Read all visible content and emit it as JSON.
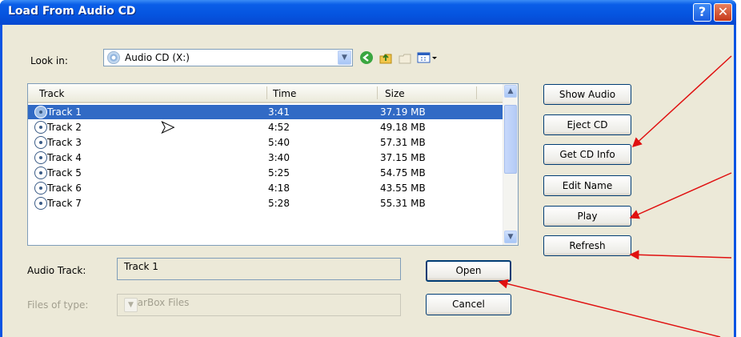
{
  "window": {
    "title": "Load From Audio CD"
  },
  "lookin": {
    "label": "Look in:",
    "value": "Audio CD (X:)"
  },
  "columns": [
    "Track",
    "Time",
    "Size"
  ],
  "tracks": [
    {
      "name": "Track 1",
      "time": "3:41",
      "size": "37.19 MB",
      "selected": true
    },
    {
      "name": "Track 2",
      "time": "4:52",
      "size": "49.18 MB"
    },
    {
      "name": "Track 3",
      "time": "5:40",
      "size": "57.31 MB"
    },
    {
      "name": "Track 4",
      "time": "3:40",
      "size": "37.15 MB"
    },
    {
      "name": "Track 5",
      "time": "5:25",
      "size": "54.75 MB"
    },
    {
      "name": "Track 6",
      "time": "4:18",
      "size": "43.55 MB"
    },
    {
      "name": "Track 7",
      "time": "5:28",
      "size": "55.31 MB"
    }
  ],
  "audio_track": {
    "label": "Audio Track:",
    "value": "Track 1"
  },
  "files_of_type": {
    "label": "Files of type:",
    "value": "GearBox Files"
  },
  "buttons": {
    "open": "Open",
    "cancel": "Cancel",
    "show_audio": "Show Audio",
    "eject_cd": "Eject CD",
    "get_cd_info": "Get CD Info",
    "edit_name": "Edit Name",
    "play": "Play",
    "refresh": "Refresh"
  },
  "colors": {
    "title_bar": "#0a54e3",
    "selection": "#316ac5",
    "annotation_arrow": "#e01010"
  }
}
